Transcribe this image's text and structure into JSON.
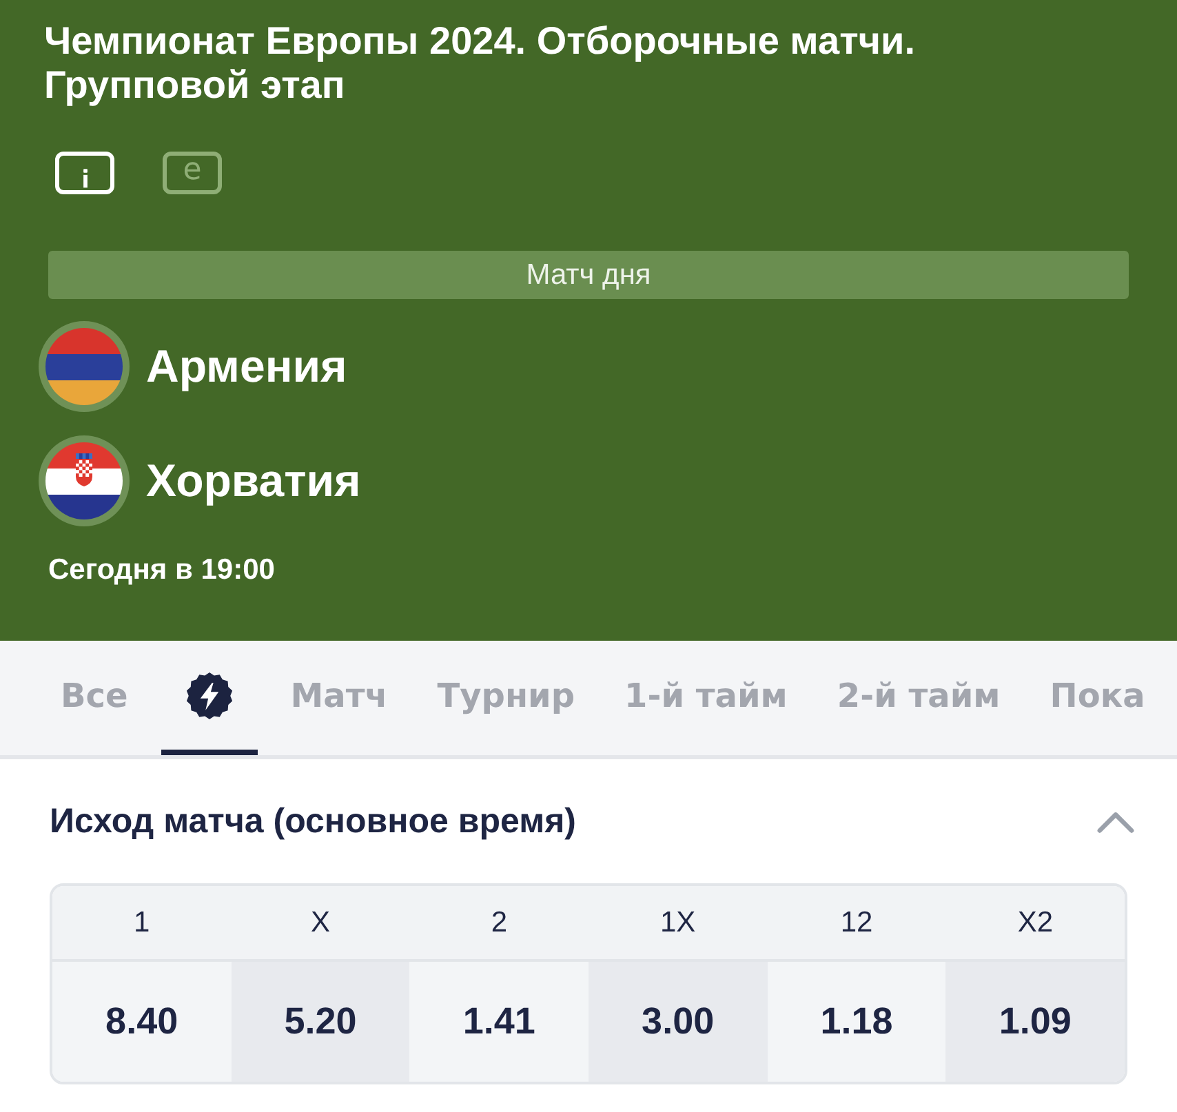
{
  "header": {
    "title": "Чемпионат Европы 2024. Отборочные матчи. Групповой этап",
    "view_buttons": [
      {
        "kind": "info",
        "selected": true
      },
      {
        "kind": "letter",
        "text": "e",
        "selected": false
      }
    ],
    "banner": "Матч дня",
    "teams": [
      {
        "name": "Армения",
        "kind": "armenia"
      },
      {
        "name": "Хорватия",
        "kind": "croatia"
      }
    ],
    "start_time": "Сегодня в 19:00"
  },
  "tabs": [
    {
      "kind": "text",
      "label": "Все",
      "selected": false
    },
    {
      "kind": "icon",
      "selected": true
    },
    {
      "kind": "text",
      "label": "Матч",
      "selected": false
    },
    {
      "kind": "text",
      "label": "Турнир",
      "selected": false
    },
    {
      "kind": "text",
      "label": "1-й тайм",
      "selected": false
    },
    {
      "kind": "text",
      "label": "2-й тайм",
      "selected": false
    },
    {
      "kind": "text",
      "label": "Пока",
      "selected": false
    }
  ],
  "market": {
    "title": "Исход матча (основное время)",
    "expanded": true,
    "outcomes": [
      {
        "label": "1",
        "odds": "8.40"
      },
      {
        "label": "X",
        "odds": "5.20"
      },
      {
        "label": "2",
        "odds": "1.41"
      },
      {
        "label": "1X",
        "odds": "3.00"
      },
      {
        "label": "12",
        "odds": "1.18"
      },
      {
        "label": "X2",
        "odds": "1.09"
      }
    ]
  }
}
